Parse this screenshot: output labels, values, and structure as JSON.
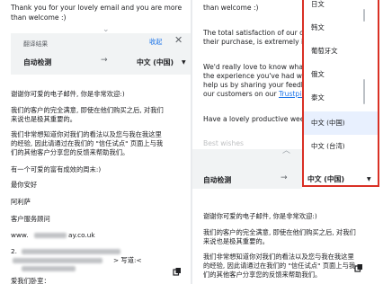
{
  "left": {
    "original_lines": [
      "Thank you for your lovely email and you are more",
      "than welcome :)"
    ],
    "header": {
      "label": "翻译结果",
      "collapse": "收起"
    },
    "lang": {
      "source": "自动检测",
      "target": "中文 (中国)"
    },
    "translated": [
      "谢谢你可爱的电子邮件, 你是非常欢迎:)",
      "我们的客户的完全满意, 即使在他们购买之后, 对我们",
      "来说也是极其重要的。",
      "我们非常想知道你对我们的看法以及您与我在我这里",
      "的经验, 因此请通过在我们的 \"信任试点\" 页面上与我",
      "们的其他客户分享您的反馈来帮助我们。",
      "有一个可爱的富有成效的周末:)",
      "最你安好",
      "阿利萨",
      "客户服务顾问",
      "www.",
      "ay.co.uk",
      "2.",
      "> 写道:<",
      "爱我们卧室："
    ]
  },
  "right": {
    "original_lines": [
      "than welcome :)",
      "The total satisfaction of our cus",
      "their purchase, is extremely im",
      "We'd really love to know what y",
      "the experience you've had with",
      "help us by sharing your feedba",
      "our customers on our ",
      "Trustpilo",
      "Have a lovely productive weeke",
      "Best wishes"
    ],
    "lang": {
      "source": "自动检测",
      "target": "中文 (中国)"
    },
    "translated": [
      "谢谢你可爱的电子邮件, 你是非常欢迎:)",
      "我们的客户的完全满意, 即使在他们购买之后, 对我们",
      "来说也是极其重要的。",
      "我们非常想知道你对我们的看法以及您与我在我这里",
      "的经验, 因此请通过在我们的 \"信任试点\" 页面上与我",
      "们的其他客户分享您的反馈来帮助我们。"
    ]
  },
  "dropdown": {
    "items": [
      "日文",
      "韩文",
      "葡萄牙文",
      "俄文",
      "泰文",
      "中文 (中国)",
      "中文 (台湾)"
    ],
    "selected_index": 5
  },
  "colors": {
    "accent": "#1a73e8",
    "highlight": "#d93025",
    "selected_bg": "#e8f0fe"
  }
}
